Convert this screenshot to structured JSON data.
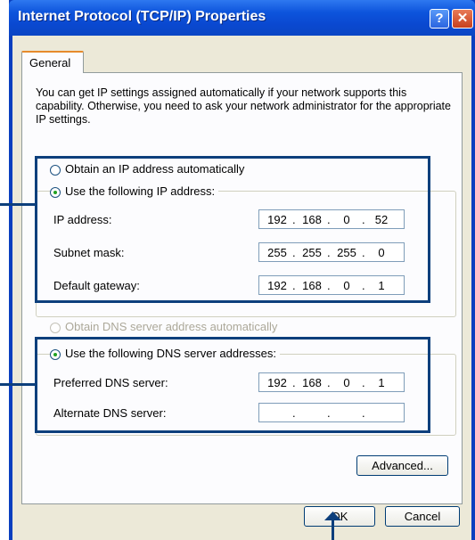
{
  "window": {
    "title": "Internet Protocol (TCP/IP) Properties",
    "help_glyph": "?",
    "close_glyph": "✕"
  },
  "tabs": [
    "General"
  ],
  "description": "You can get IP settings assigned automatically if your network supports this capability. Otherwise, you need to ask your network administrator for the appropriate IP settings.",
  "ip_mode": {
    "auto_label": "Obtain an IP address automatically",
    "manual_label": "Use the following IP address:",
    "selected": "manual"
  },
  "ip_fields": {
    "ip_address": {
      "label": "IP address:",
      "octets": [
        "192",
        "168",
        "0",
        "52"
      ]
    },
    "subnet_mask": {
      "label": "Subnet mask:",
      "octets": [
        "255",
        "255",
        "255",
        "0"
      ]
    },
    "default_gateway": {
      "label": "Default gateway:",
      "octets": [
        "192",
        "168",
        "0",
        "1"
      ]
    }
  },
  "dns_mode": {
    "auto_label": "Obtain DNS server address automatically",
    "manual_label": "Use the following DNS server addresses:",
    "selected": "manual"
  },
  "dns_fields": {
    "preferred": {
      "label": "Preferred DNS server:",
      "octets": [
        "192",
        "168",
        "0",
        "1"
      ]
    },
    "alternate": {
      "label": "Alternate DNS server:",
      "octets": [
        "",
        "",
        "",
        ""
      ]
    }
  },
  "buttons": {
    "advanced": "Advanced...",
    "ok": "OK",
    "cancel": "Cancel"
  },
  "colors": {
    "callout": "#0d3f7c",
    "titlebar": "#0a48d0",
    "dialog_bg": "#ece9d8"
  }
}
